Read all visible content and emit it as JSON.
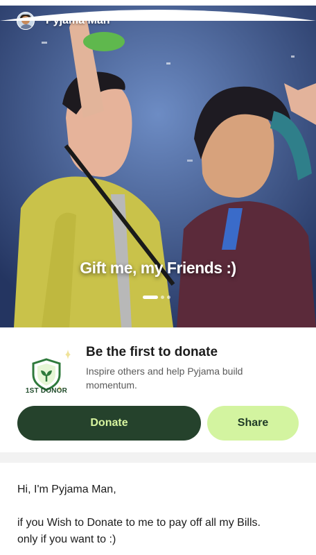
{
  "profile": {
    "username": "Pyjama Man"
  },
  "hero": {
    "caption": "Gift me, my Friends :)",
    "carousel_total": 3,
    "carousel_active": 1
  },
  "donor_card": {
    "badge_label": "1ST DONOR",
    "title": "Be the first to donate",
    "subtitle": "Inspire others and help Pyjama build momentum."
  },
  "actions": {
    "donate_label": "Donate",
    "share_label": "Share"
  },
  "description": {
    "line1": "Hi, I'm Pyjama Man,",
    "line2": "if you Wish to Donate to me to pay off all my Bills.",
    "line3": "only if you want to :)"
  },
  "colors": {
    "primary_dark": "#25422c",
    "accent_light": "#d3f4a0",
    "badge_green": "#2f7a3c"
  }
}
